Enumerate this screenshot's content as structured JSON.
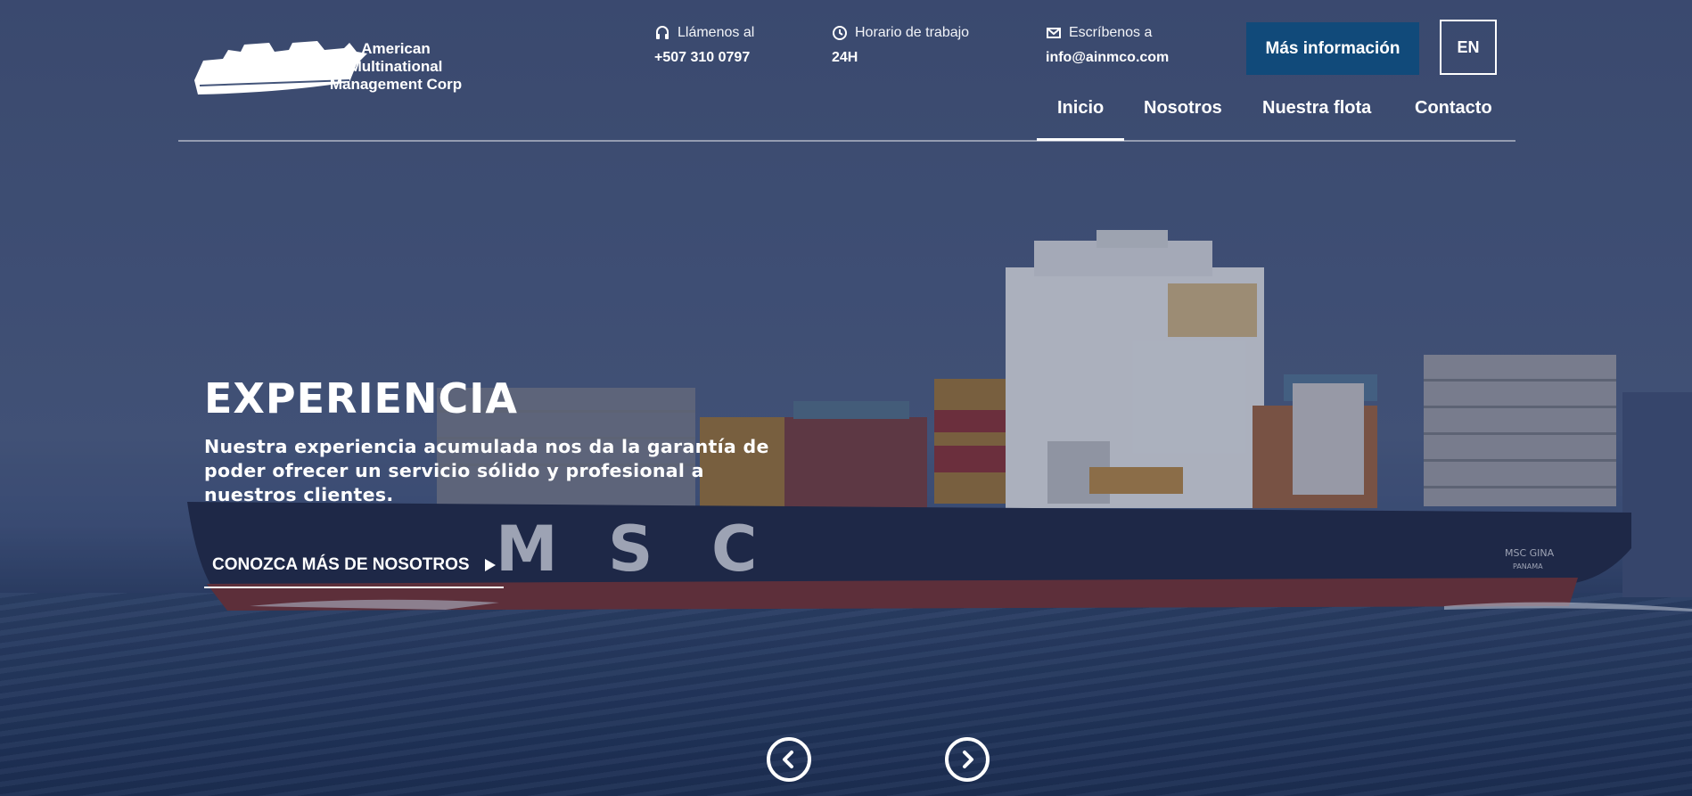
{
  "brand": {
    "line1": "American",
    "line2": "Multinational",
    "line3": "Management Corp"
  },
  "contact": {
    "phone": {
      "label": "Llámenos al",
      "value": "+507 310 0797",
      "icon": "headset-icon"
    },
    "hours": {
      "label": "Horario de trabajo",
      "value": "24H",
      "icon": "clock-icon"
    },
    "email": {
      "label": "Escríbenos a",
      "value": "info@ainmco.com",
      "icon": "envelope-icon"
    }
  },
  "buttons": {
    "more_info": "Más información",
    "lang": "EN"
  },
  "nav": {
    "items": [
      "Inicio",
      "Nosotros",
      "Nuestra flota",
      "Contacto"
    ],
    "active": "Inicio"
  },
  "hero": {
    "title": "EXPERIENCIA",
    "description": "Nuestra experiencia acumulada nos da la garantía de poder ofrecer un servicio sólido y profesional a nuestros clientes.",
    "cta": "CONOZCA MÁS DE NOSOTROS",
    "ship_name": "MSC GINA",
    "ship_port": "PANAMA",
    "hull_letters": [
      "M",
      "S",
      "C"
    ]
  },
  "slider": {
    "prev_icon": "chevron-left-circle-icon",
    "next_icon": "chevron-right-circle-icon"
  },
  "colors": {
    "accent": "#114a7a",
    "text": "#ffffff"
  }
}
